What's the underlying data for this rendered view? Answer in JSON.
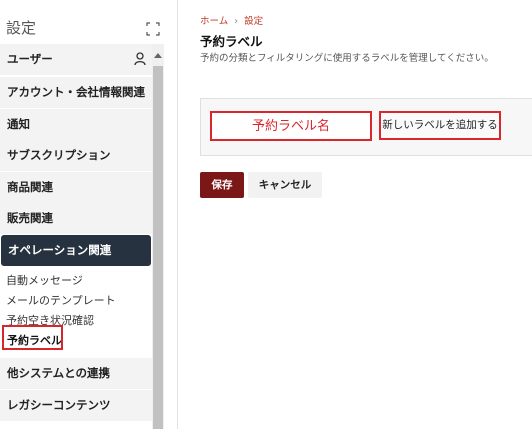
{
  "sidebar": {
    "title": "設定",
    "expand_icon": "expand-icon",
    "items": [
      {
        "label": "ユーザー",
        "icon": "user-icon"
      },
      {
        "label": "アカウント・会社情報関連"
      },
      {
        "label": "通知"
      },
      {
        "label": "サブスクリプション"
      },
      {
        "label": "商品関連"
      },
      {
        "label": "販売関連"
      },
      {
        "label": "オペレーション関連",
        "active": true
      },
      {
        "label": "他システムとの連携"
      },
      {
        "label": "レガシーコンテンツ"
      }
    ],
    "subitems": [
      {
        "label": "自動メッセージ"
      },
      {
        "label": "メールのテンプレート"
      },
      {
        "label": "予約空き状況確認"
      },
      {
        "label": "予約ラベル",
        "selected": true
      }
    ]
  },
  "breadcrumb": {
    "home": "ホーム",
    "current": "設定"
  },
  "page": {
    "title": "予約ラベル",
    "description": "予約の分類とフィルタリングに使用するラベルを管理してください。"
  },
  "form": {
    "name_placeholder": "予約ラベル名",
    "add_label": "新しいラベルを追加する"
  },
  "actions": {
    "save": "保存",
    "cancel": "キャンセル"
  },
  "colors": {
    "accent": "#7b1717",
    "highlight": "#d9262c",
    "active_nav": "#273240"
  }
}
